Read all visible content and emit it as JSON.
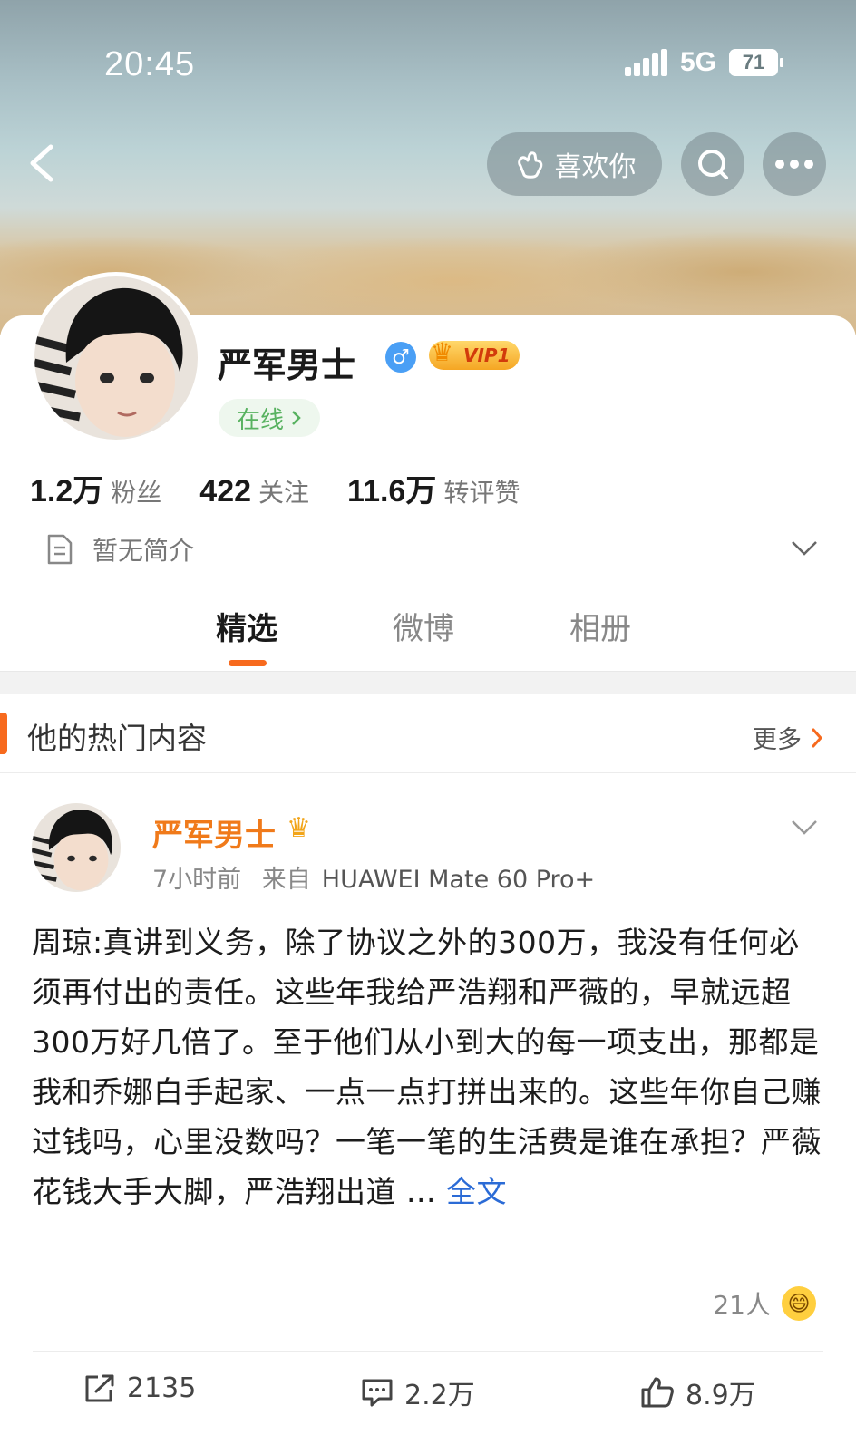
{
  "status": {
    "time": "20:45",
    "network": "5G",
    "battery": "71"
  },
  "header": {
    "like_label": "喜欢你"
  },
  "profile": {
    "name": "严军男士",
    "gender_symbol": "♂",
    "vip_label": "VIP1",
    "online_label": "在线",
    "stats": [
      {
        "value": "1.2万",
        "label": "粉丝"
      },
      {
        "value": "422",
        "label": "关注"
      },
      {
        "value": "11.6万",
        "label": "转评赞"
      }
    ],
    "bio": "暂无简介"
  },
  "tabs": [
    {
      "label": "精选",
      "active": true
    },
    {
      "label": "微博",
      "active": false
    },
    {
      "label": "相册",
      "active": false
    }
  ],
  "section": {
    "title": "他的热门内容",
    "more_label": "更多"
  },
  "post": {
    "author": "严军男士",
    "time": "7小时前",
    "source": "来自",
    "device": "HUAWEI Mate 60 Pro+",
    "text": "周琼:真讲到义务，除了协议之外的300万，我没有任何必须再付出的责任。这些年我给严浩翔和严薇的，早就远超300万好几倍了。至于他们从小到大的每一项支出，那都是我和乔娜白手起家、一点一点打拼出来的。这些年你自己赚过钱吗，心里没数吗？一笔一笔的生活费是谁在承担？严薇花钱大手大脚，严浩翔出道 ...",
    "more_label": "全文",
    "reaction_count": "21人",
    "reposts": "2135",
    "comments": "2.2万",
    "likes": "8.9万"
  },
  "colors": {
    "accent": "#f76a1e",
    "link": "#2b6bd6",
    "online": "#58b260"
  }
}
